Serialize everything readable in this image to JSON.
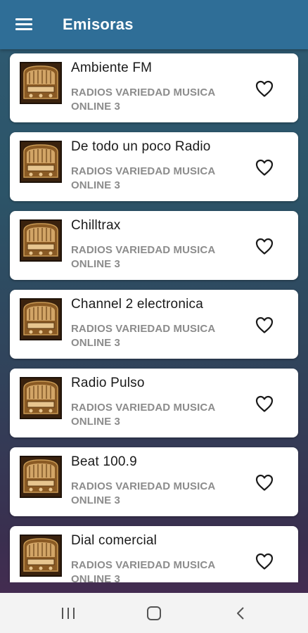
{
  "appbar": {
    "title": "Emisoras",
    "menu_icon": "menu-icon"
  },
  "stations": [
    {
      "name": "Ambiente FM",
      "category": "RADIOS VARIEDAD MUSICA ONLINE 3"
    },
    {
      "name": "De todo un poco Radio",
      "category": "RADIOS VARIEDAD MUSICA ONLINE 3"
    },
    {
      "name": "Chilltrax",
      "category": "RADIOS VARIEDAD MUSICA ONLINE 3"
    },
    {
      "name": "Channel 2 electronica",
      "category": "RADIOS VARIEDAD MUSICA ONLINE 3"
    },
    {
      "name": "Radio Pulso",
      "category": "RADIOS VARIEDAD MUSICA ONLINE 3"
    },
    {
      "name": "Beat 100.9",
      "category": "RADIOS VARIEDAD MUSICA ONLINE 3"
    },
    {
      "name": "Dial comercial",
      "category": "RADIOS VARIEDAD MUSICA ONLINE 3"
    }
  ],
  "icons": {
    "thumbnail": "vintage-radio-icon",
    "favorite": "heart-outline-icon"
  },
  "navbar": {
    "recents": "recents-icon",
    "home": "home-icon",
    "back": "back-icon"
  },
  "colors": {
    "appbar": "#2f6e97",
    "card": "#ffffff",
    "title_text": "#1a1a1a",
    "subtitle_text": "#8c8c8c"
  }
}
